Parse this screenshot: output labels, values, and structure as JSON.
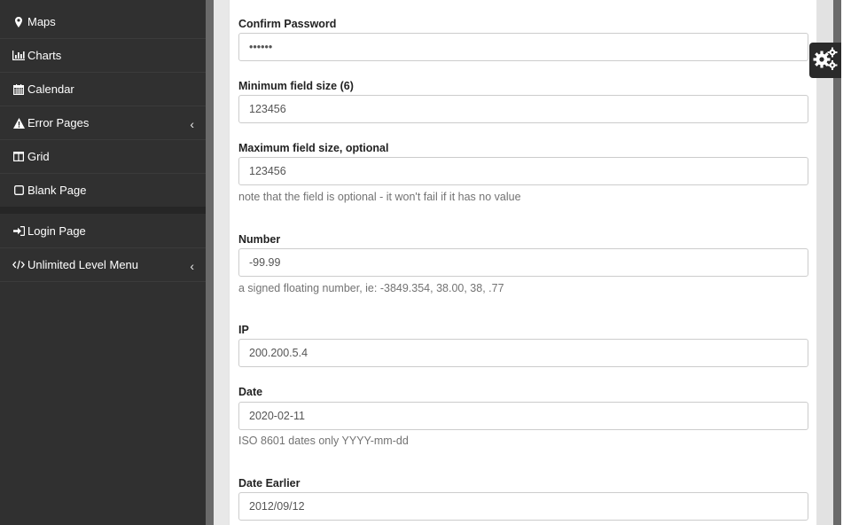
{
  "sidebar": {
    "items": [
      {
        "label": "Maps",
        "icon": "map-marker-icon"
      },
      {
        "label": "Charts",
        "icon": "bar-chart-icon"
      },
      {
        "label": "Calendar",
        "icon": "calendar-icon"
      },
      {
        "label": "Error Pages",
        "icon": "warning-icon",
        "expandable": true
      },
      {
        "label": "Grid",
        "icon": "columns-icon"
      },
      {
        "label": "Blank Page",
        "icon": "square-icon"
      },
      {
        "label": "Login Page",
        "icon": "sign-in-icon"
      },
      {
        "label": "Unlimited Level Menu",
        "icon": "code-icon",
        "expandable": true
      }
    ],
    "chevron": "‹"
  },
  "form": {
    "confirm_password": {
      "label": "Confirm Password",
      "value": "••••••"
    },
    "min_field": {
      "label": "Minimum field size (6)",
      "value": "123456"
    },
    "max_field": {
      "label": "Maximum field size, optional",
      "value": "123456",
      "help": "note that the field is optional - it won't fail if it has no value"
    },
    "number": {
      "label": "Number",
      "value": "-99.99",
      "help": "a signed floating number, ie: -3849.354, 38.00, 38, .77"
    },
    "ip": {
      "label": "IP",
      "value": "200.200.5.4"
    },
    "date": {
      "label": "Date",
      "value": "2020-02-11",
      "help": "ISO 8601 dates only YYYY-mm-dd"
    },
    "date_earlier": {
      "label": "Date Earlier",
      "value": "2012/09/12"
    }
  },
  "settings_widget": {
    "icon": "gears-icon"
  },
  "colors": {
    "sidebar_bg": "#303030",
    "panel_bg": "#ffffff",
    "widget_bg": "#2a2a2a"
  }
}
